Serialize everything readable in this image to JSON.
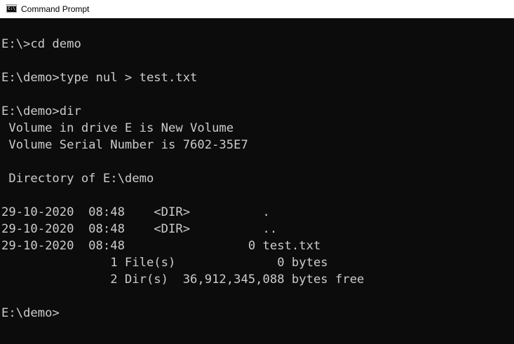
{
  "window": {
    "title": "Command Prompt",
    "icon": "command-prompt-icon"
  },
  "console": {
    "lines": [
      "E:\\>cd demo",
      "",
      "E:\\demo>type nul > test.txt",
      "",
      "E:\\demo>dir",
      " Volume in drive E is New Volume",
      " Volume Serial Number is 7602-35E7",
      "",
      " Directory of E:\\demo",
      "",
      "29-10-2020  08:48    <DIR>          .",
      "29-10-2020  08:48    <DIR>          ..",
      "29-10-2020  08:48                 0 test.txt",
      "               1 File(s)              0 bytes",
      "               2 Dir(s)  36,912,345,088 bytes free",
      "",
      "E:\\demo>"
    ]
  },
  "colors": {
    "background": "#0c0c0c",
    "text": "#cccccc",
    "titlebar": "#ffffff"
  }
}
